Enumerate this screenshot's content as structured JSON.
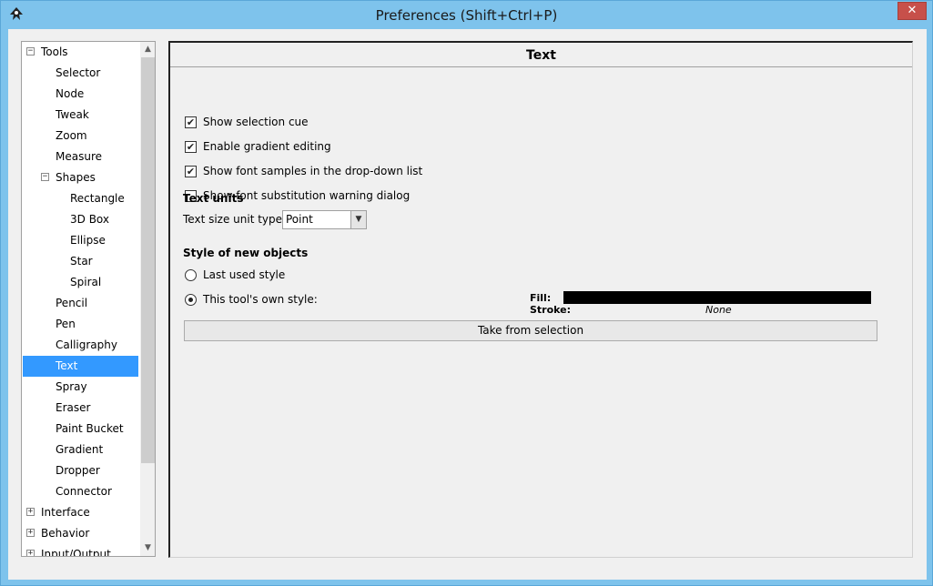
{
  "window": {
    "title": "Preferences (Shift+Ctrl+P)",
    "close_glyph": "✕",
    "app_icon": "inkscape-icon"
  },
  "tree": {
    "items": [
      {
        "label": "Tools",
        "toggle": "−",
        "level": 0
      },
      {
        "label": "Selector",
        "level": 1
      },
      {
        "label": "Node",
        "level": 1
      },
      {
        "label": "Tweak",
        "level": 1
      },
      {
        "label": "Zoom",
        "level": 1
      },
      {
        "label": "Measure",
        "level": 1
      },
      {
        "label": "Shapes",
        "toggle": "−",
        "level": 1
      },
      {
        "label": "Rectangle",
        "level": 2
      },
      {
        "label": "3D Box",
        "level": 2
      },
      {
        "label": "Ellipse",
        "level": 2
      },
      {
        "label": "Star",
        "level": 2
      },
      {
        "label": "Spiral",
        "level": 2
      },
      {
        "label": "Pencil",
        "level": 1
      },
      {
        "label": "Pen",
        "level": 1
      },
      {
        "label": "Calligraphy",
        "level": 1
      },
      {
        "label": "Text",
        "level": 1,
        "selected": true
      },
      {
        "label": "Spray",
        "level": 1
      },
      {
        "label": "Eraser",
        "level": 1
      },
      {
        "label": "Paint Bucket",
        "level": 1
      },
      {
        "label": "Gradient",
        "level": 1
      },
      {
        "label": "Dropper",
        "level": 1
      },
      {
        "label": "Connector",
        "level": 1
      },
      {
        "label": "Interface",
        "toggle": "+",
        "level": 0
      },
      {
        "label": "Behavior",
        "toggle": "+",
        "level": 0
      },
      {
        "label": "Input/Output",
        "toggle": "+",
        "level": 0
      }
    ],
    "scroll_up_glyph": "▲",
    "scroll_down_glyph": "▼"
  },
  "main": {
    "title": "Text",
    "checkboxes": [
      {
        "label": "Show selection cue",
        "checked": true
      },
      {
        "label": "Enable gradient editing",
        "checked": true
      },
      {
        "label": "Show font samples in the drop-down list",
        "checked": true
      },
      {
        "label": "Show font substitution warning dialog",
        "checked": false
      }
    ],
    "text_units": {
      "heading": "Text units",
      "size_label": "Text size unit type:",
      "size_value": "Point",
      "dropdown_glyph": "▼"
    },
    "style": {
      "heading": "Style of new objects",
      "options": [
        {
          "label": "Last used style",
          "selected": false
        },
        {
          "label": "This tool's own style:",
          "selected": true
        }
      ],
      "fill_label": "Fill:",
      "fill_color": "#000000",
      "stroke_label": "Stroke:",
      "stroke_value": "None",
      "take_button": "Take from selection"
    }
  },
  "colors": {
    "frame": "#7ec3ec",
    "selection": "#3399ff",
    "close": "#c7504a"
  }
}
